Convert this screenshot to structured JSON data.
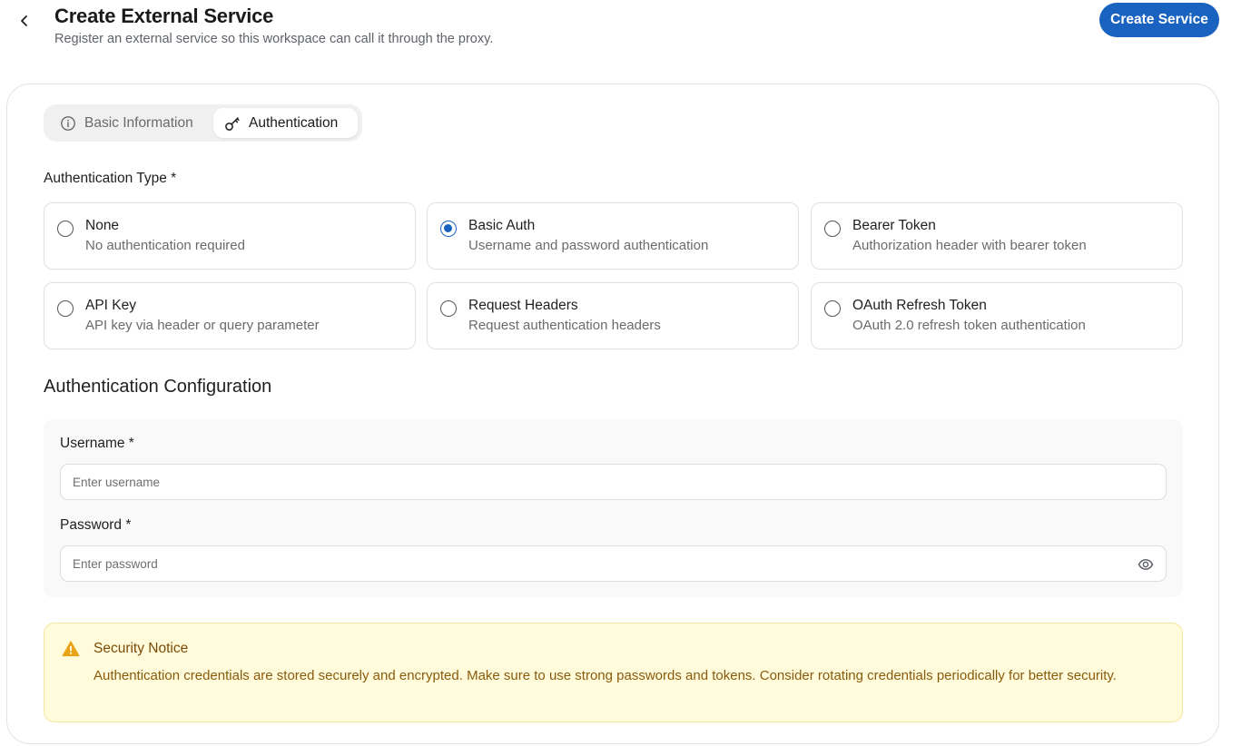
{
  "header": {
    "title": "Create External Service",
    "subtitle": "Register an external service so this workspace can call it through the proxy.",
    "create_button": "Create Service"
  },
  "tabs": [
    {
      "label": "Basic Information",
      "icon": "info-icon",
      "active": false
    },
    {
      "label": "Authentication",
      "icon": "key-icon",
      "active": true
    }
  ],
  "auth_type": {
    "label": "Authentication Type *",
    "selected": "Basic Auth",
    "options": [
      {
        "title": "None",
        "description": "No authentication required"
      },
      {
        "title": "Basic Auth",
        "description": "Username and password authentication"
      },
      {
        "title": "Bearer Token",
        "description": "Authorization header with bearer token"
      },
      {
        "title": "API Key",
        "description": "API key via header or query parameter"
      },
      {
        "title": "Request Headers",
        "description": "Request authentication headers"
      },
      {
        "title": "OAuth Refresh Token",
        "description": "OAuth 2.0 refresh token authentication"
      }
    ]
  },
  "config": {
    "title": "Authentication Configuration",
    "username": {
      "label": "Username *",
      "placeholder": "Enter username",
      "value": ""
    },
    "password": {
      "label": "Password *",
      "placeholder": "Enter password",
      "value": ""
    }
  },
  "notice": {
    "title": "Security Notice",
    "text": "Authentication credentials are stored securely and encrypted. Make sure to use strong passwords and tokens. Consider rotating credentials periodically for better security."
  },
  "colors": {
    "primary": "#1a62c0",
    "notice_bg": "#fffbdb",
    "notice_text": "#8a5a0c",
    "warning_icon": "#e8a317"
  }
}
